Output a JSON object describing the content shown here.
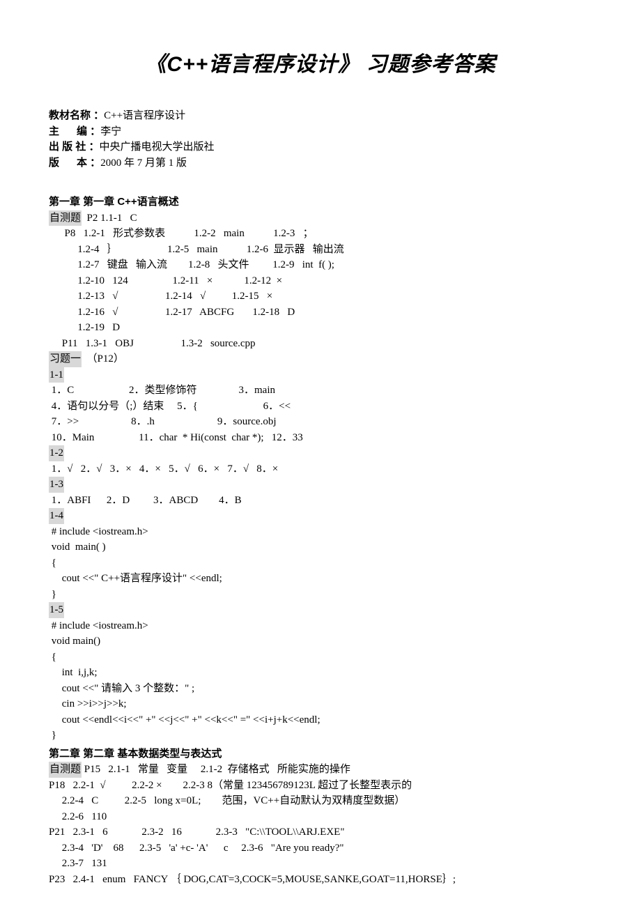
{
  "title": "《C++语言程序设计》 习题参考答案",
  "meta": {
    "name_label": "教材名称 ：",
    "name_value": "C++语言程序设计",
    "editor_label": "主      编 ：",
    "editor_value": "李宁",
    "publisher_label": "出 版 社 ：",
    "publisher_value": "中央广播电视大学出版社",
    "edition_label": "版      本 ：",
    "edition_value": "2000 年 7 月第 1 版"
  },
  "ch1": {
    "heading": "第一章   第一章   C++语言概述",
    "selftest_label": "自测题",
    "selftest_p2": "  P2 1.1-1   C",
    "p8": [
      "      P8   1.2-1   形式参数表           1.2-2   main           1.2-3   ；",
      "           1.2-4   ｝                   1.2-5   main           1.2-6  显示器   输出流",
      "           1.2-7   键盘   输入流        1.2-8   头文件         1.2-9   int  f( );",
      "           1.2-10   124                 1.2-11   ×            1.2-12  ×",
      "           1.2-13   √                  1.2-14   √          1.2-15   ×",
      "           1.2-16   √                  1.2-17   ABCFG       1.2-18   D",
      "           1.2-19   D",
      "     P11   1.3-1   OBJ                  1.3-2   source.cpp"
    ],
    "ex1_label": "习题一",
    "ex1_paren": "  （P12）",
    "s1_1_label": "1-1",
    "s1_1_lines": [
      " 1．C                     2．类型修饰符                3．main",
      " 4．语句以分号（;）结束     5．{                         6．<<",
      " 7．>>                    8．.h                        9．source.obj",
      " 10．Main                 11．char  * Hi(const  char *);   12．33"
    ],
    "s1_2_label": "1-2",
    "s1_2_line": " 1．√   2．√   3．×   4．×   5．√   6．×   7．√   8．×",
    "s1_3_label": "1-3",
    "s1_3_line": " 1．ABFI      2．D         3．ABCD        4．B",
    "s1_4_label": "1-4",
    "s1_4_code": [
      " # include <iostream.h>",
      " void  main( )",
      " {",
      "     cout <<\" C++语言程序设计\" <<endl;",
      " }"
    ],
    "s1_5_label": "1-5",
    "s1_5_code": [
      " # include <iostream.h>",
      " void main()",
      " {",
      "     int  i,j,k;",
      "     cout <<\" 请输入 3 个整数：\" ;",
      "     cin >>i>>j>>k;",
      "     cout <<endl<<i<<\" +\" <<j<<\" +\" <<k<<\" =\" <<i+j+k<<endl;",
      " }"
    ]
  },
  "ch2": {
    "heading": "第二章   第二章   基本数据类型与表达式",
    "selftest_label": "自测题",
    "line1_rest": " P15   2.1-1   常量   变量     2.1-2  存储格式   所能实施的操作",
    "lines": [
      "P18   2.2-1  √          2.2-2 ×        2.2-3 8（常量 123456789123L 超过了长整型表示的",
      "     2.2-4   C          2.2-5   long x=0L;        范围，VC++自动默认为双精度型数据）",
      "     2.2-6   110",
      "P21   2.3-1   6             2.3-2   16             2.3-3   \"C:\\\\TOOL\\\\ARJ.EXE\"",
      "     2.3-4   'D'    68      2.3-5   'a' +c- 'A'      c     2.3-6   \"Are you ready?\"",
      "     2.3-7   131",
      "P23   2.4-1   enum   FANCY ｛ DOG,CAT=3,COCK=5,MOUSE,SANKE,GOAT=11,HORSE｝;"
    ]
  }
}
